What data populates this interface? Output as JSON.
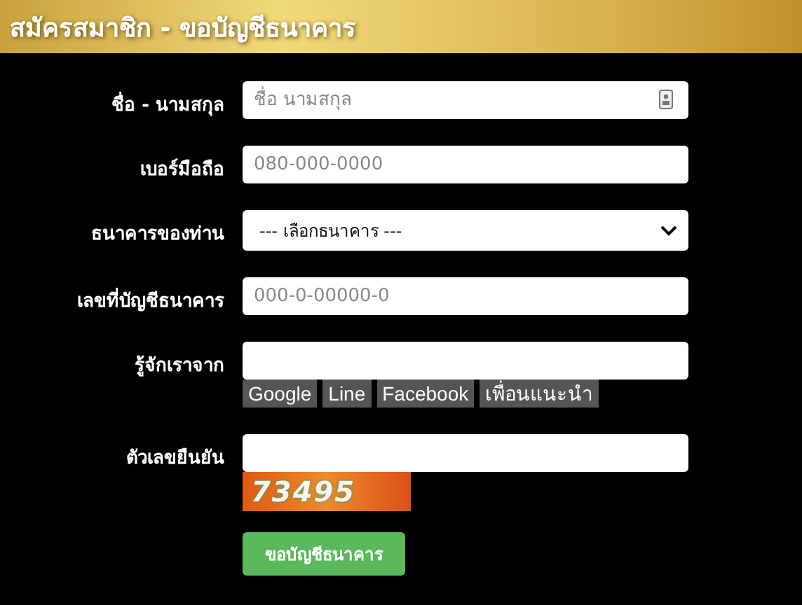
{
  "header": {
    "title": "สมัครสมาชิก - ขอบัญชีธนาคาร"
  },
  "fields": [
    {
      "kind": "text",
      "label": "ชื่อ - นามสกุล",
      "placeholder": "ชื่อ นามสกุล",
      "contact_icon": true
    },
    {
      "kind": "text",
      "label": "เบอร์มือถือ",
      "placeholder": "080-000-0000"
    },
    {
      "kind": "select",
      "label": "ธนาคารของท่าน",
      "value": "--- เลือกธนาคาร ---"
    },
    {
      "kind": "text",
      "label": "เลขที่บัญชีธนาคาร",
      "placeholder": "000-0-00000-0"
    },
    {
      "kind": "text",
      "label": "รู้จักเราจาก",
      "chips": [
        "Google",
        "Line",
        "Facebook",
        "เพื่อนแนะนำ"
      ]
    },
    {
      "kind": "text",
      "label": "ตัวเลขยืนยัน",
      "captcha": "73495"
    }
  ],
  "submit_button": "ขอบัญชีธนาคาร"
}
